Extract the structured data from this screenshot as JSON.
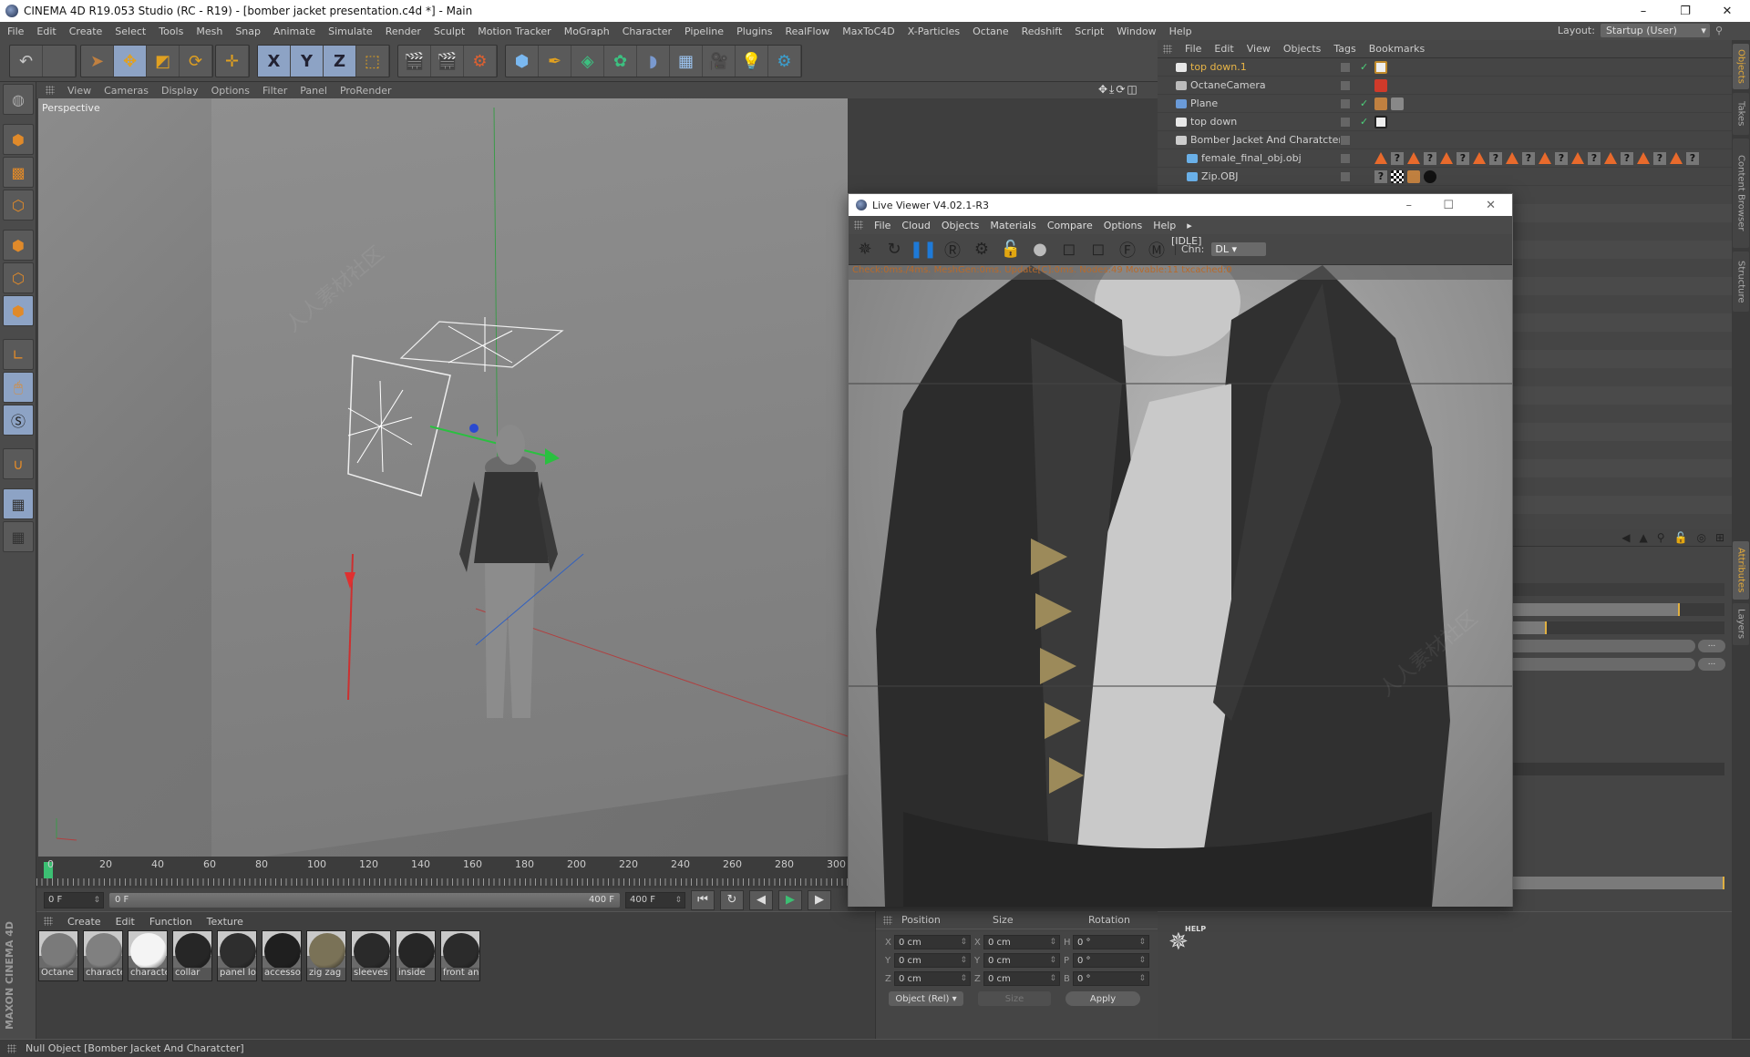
{
  "window": {
    "title": "CINEMA 4D R19.053 Studio (RC - R19) - [bomber jacket presentation.c4d *] - Main",
    "controls": [
      "–",
      "❐",
      "✕"
    ]
  },
  "menubar": {
    "items": [
      "File",
      "Edit",
      "Create",
      "Select",
      "Tools",
      "Mesh",
      "Snap",
      "Animate",
      "Simulate",
      "Render",
      "Sculpt",
      "Motion Tracker",
      "MoGraph",
      "Character",
      "Pipeline",
      "Plugins",
      "RealFlow",
      "MaxToC4D",
      "X-Particles",
      "Octane",
      "Redshift",
      "Script",
      "Window",
      "Help"
    ],
    "layout_label": "Layout:",
    "layout_value": "Startup (User)"
  },
  "toolbar": {
    "icons": [
      "undo-icon",
      "redo-icon",
      "select-icon",
      "move-icon",
      "scale-icon",
      "rotate-icon",
      "recent-tool-icon",
      "x-axis-icon",
      "y-axis-icon",
      "z-axis-icon",
      "coordinate-system-icon",
      "render-view-icon",
      "render-picture-viewer-icon",
      "render-settings-icon",
      "cube-icon",
      "pen-icon",
      "subdivision-icon",
      "cloner-icon",
      "deformer-icon",
      "floor-icon",
      "camera-icon",
      "light-icon",
      "octane-icon"
    ],
    "axis_labels": [
      "X",
      "Y",
      "Z"
    ]
  },
  "left_tools": [
    "model-mode-icon",
    "texture-mode-icon",
    "workplane-icon",
    "points-mode-icon",
    "edges-mode-icon",
    "polygons-mode-icon",
    "axis-mode-icon",
    "tweak-mode-icon",
    "solo-icon",
    "snap-icon",
    "lock-workplane-icon",
    "planar-workplane-icon"
  ],
  "viewport": {
    "menu": [
      "View",
      "Cameras",
      "Display",
      "Options",
      "Filter",
      "Panel",
      "ProRender"
    ],
    "label": "Perspective"
  },
  "timeline": {
    "ticks": [
      "0",
      "20",
      "40",
      "60",
      "80",
      "100",
      "120",
      "140",
      "160",
      "180",
      "200",
      "220",
      "240",
      "260",
      "280",
      "300"
    ],
    "current_frame": "0 F",
    "range_start": "0 F",
    "range_end": "400 F",
    "end_frame": "400 F"
  },
  "materials": {
    "menu": [
      "Create",
      "Edit",
      "Function",
      "Texture"
    ],
    "items": [
      {
        "label": "Octane",
        "color": "#7a7a7a"
      },
      {
        "label": "characte",
        "color": "#808080"
      },
      {
        "label": "characte",
        "color": "#f4f4f4"
      },
      {
        "label": "collar",
        "color": "#262626"
      },
      {
        "label": "panel lo",
        "color": "#2e2e2e"
      },
      {
        "label": "accessoi",
        "color": "#1f1f1f"
      },
      {
        "label": "zig zag",
        "color": "#7a7257"
      },
      {
        "label": "sleeves",
        "color": "#2a2a2a"
      },
      {
        "label": "inside",
        "color": "#262626"
      },
      {
        "label": "front an",
        "color": "#2b2b2b"
      }
    ]
  },
  "coordinates": {
    "headers": [
      "Position",
      "Size",
      "Rotation"
    ],
    "rows": [
      {
        "pos_axis": "X",
        "pos": "0 cm",
        "size_axis": "X",
        "size": "0 cm",
        "rot_axis": "H",
        "rot": "0 °"
      },
      {
        "pos_axis": "Y",
        "pos": "0 cm",
        "size_axis": "Y",
        "size": "0 cm",
        "rot_axis": "P",
        "rot": "0 °"
      },
      {
        "pos_axis": "Z",
        "pos": "0 cm",
        "size_axis": "Z",
        "size": "0 cm",
        "rot_axis": "B",
        "rot": "0 °"
      }
    ],
    "mode": "Object (Rel)",
    "size_mode": "Size",
    "apply": "Apply"
  },
  "object_manager": {
    "menu": [
      "File",
      "Edit",
      "View",
      "Objects",
      "Tags",
      "Bookmarks"
    ],
    "objects": [
      {
        "name": "top down.1",
        "icon": "light-area-icon",
        "selected": true,
        "check": true
      },
      {
        "name": "OctaneCamera",
        "icon": "camera-icon",
        "selected": false,
        "check": false
      },
      {
        "name": "Plane",
        "icon": "plane-icon",
        "selected": false,
        "check": true
      },
      {
        "name": "top down",
        "icon": "light-area-icon",
        "selected": false,
        "check": true
      },
      {
        "name": "Bomber Jacket And Charatcter",
        "icon": "null-icon",
        "selected": false,
        "check": false
      },
      {
        "name": "female_final_obj.obj",
        "icon": "polygon-object-icon",
        "selected": false,
        "check": false
      },
      {
        "name": "Zip.OBJ",
        "icon": "polygon-object-icon",
        "selected": false,
        "check": false
      }
    ]
  },
  "right_tabs": {
    "top": [
      "Objects",
      "Takes",
      "Content Browser",
      "Structure"
    ],
    "bottom": [
      "Attributes",
      "Layers"
    ]
  },
  "attributes": {
    "slider1_value": 0.79,
    "slider2_value": 0.16,
    "slider3_value": 1.0,
    "more_button": "..."
  },
  "help_panel": {
    "label": "HELP"
  },
  "live_viewer": {
    "title": "Live Viewer V4.02.1-R3",
    "menu": [
      "File",
      "Cloud",
      "Objects",
      "Materials",
      "Compare",
      "Options",
      "Help"
    ],
    "state": "[IDLE]",
    "channel_label": "Chn:",
    "channel_value": "DL",
    "status": "Check:0ms./4ms. MeshGen:0ms. Update[C]:0ms. Nodes:49 Movable:11 txcached:0"
  },
  "statusbar": {
    "text": "Null Object [Bomber Jacket And Charatcter]"
  },
  "brand": {
    "vertical": "MAXON CINEMA 4D"
  },
  "colors": {
    "accent_orange": "#e08a2a",
    "selected_text": "#e8b547",
    "toolbar_active": "#8da3c5",
    "checkmark": "#4cd07a"
  }
}
